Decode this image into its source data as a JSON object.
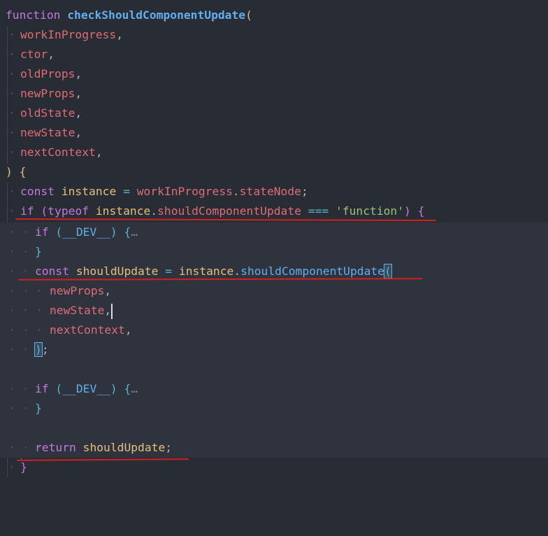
{
  "code": {
    "l1": {
      "kw": "function",
      "name": "checkShouldComponentUpdate",
      "open": "("
    },
    "params": [
      "workInProgress",
      "ctor",
      "oldProps",
      "newProps",
      "oldState",
      "newState",
      "nextContext"
    ],
    "comma": ",",
    "l9": {
      "close": ")",
      "brace": "{"
    },
    "l10": {
      "kw": "const",
      "name": "instance",
      "eq": "=",
      "obj": "workInProgress",
      "dot": ".",
      "prop": "stateNode",
      "semi": ";"
    },
    "l11": {
      "kw": "if",
      "open": "(",
      "typeof": "typeof",
      "obj": "instance",
      "dot": ".",
      "prop": "shouldComponentUpdate",
      "op": "===",
      "str": "'function'",
      "close": ")",
      "brace": "{"
    },
    "l12": {
      "kw": "if",
      "open": "(",
      "name": "__DEV__",
      "close": ")",
      "brace": "{",
      "fold": "…"
    },
    "l13": {
      "brace": "}"
    },
    "l14": {
      "kw": "const",
      "name": "shouldUpdate",
      "eq": "=",
      "obj": "instance",
      "dot": ".",
      "method": "shouldComponentUpdate",
      "open": "("
    },
    "l15": {
      "arg": "newProps",
      "comma": ","
    },
    "l16": {
      "arg": "newState",
      "comma": ","
    },
    "l17": {
      "arg": "nextContext",
      "comma": ","
    },
    "l18": {
      "close": ")",
      "semi": ";"
    },
    "l20": {
      "kw": "if",
      "open": "(",
      "name": "__DEV__",
      "close": ")",
      "brace": "{",
      "fold": "…"
    },
    "l21": {
      "brace": "}"
    },
    "l23": {
      "kw": "return",
      "name": "shouldUpdate",
      "semi": ";"
    },
    "l24": {
      "brace": "}"
    }
  },
  "colors": {
    "background": "#282c34",
    "keyword": "#c678dd",
    "function": "#61afef",
    "variable": "#e06c75",
    "local": "#e5c07b",
    "string": "#98c379",
    "operator": "#56b6c2",
    "annotation": "#d41f1f"
  }
}
